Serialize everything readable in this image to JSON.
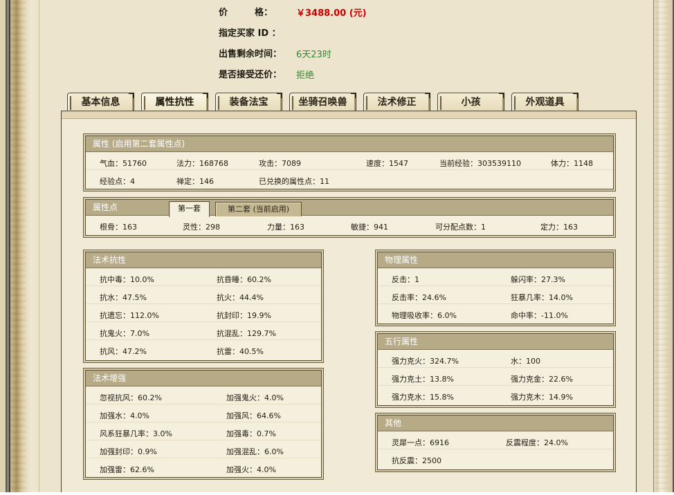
{
  "header": {
    "price_label": "价　　　格：",
    "price_value": "￥3488.00 (元)",
    "buyer_label": "指定买家 ID ：",
    "buyer_value": "",
    "time_label": "出售剩余时间：",
    "time_value": "6天23时",
    "counter_label": "是否接受还价：",
    "counter_value": "拒绝"
  },
  "tabs": [
    "基本信息",
    "属性抗性",
    "装备法宝",
    "坐骑召唤兽",
    "法术修正",
    "小孩",
    "外观道具"
  ],
  "active_tab": "属性抗性",
  "attributes": {
    "title": "属性 (启用第二套属性点)",
    "row1": [
      "气血：51760",
      "法力：168768",
      "攻击：7089",
      "速度：1547",
      "当前经验：303539110",
      "体力：1148"
    ],
    "row2": [
      "经验点：4",
      "禅定：146",
      "已兑换的属性点：11"
    ]
  },
  "points": {
    "title": "属性点",
    "subtabs": [
      "第一套",
      "第二套 (当前启用)"
    ],
    "active_subtab": "第一套",
    "values": [
      "根骨：163",
      "灵性：298",
      "力量：163",
      "敏捷：941",
      "可分配点数：1",
      "定力：163"
    ]
  },
  "spell_resist": {
    "title": "法术抗性",
    "rows": [
      [
        "抗中毒：10.0%",
        "抗昏睡：60.2%"
      ],
      [
        "抗水：47.5%",
        "抗火：44.4%"
      ],
      [
        "抗遗忘：112.0%",
        "抗封印：19.9%"
      ],
      [
        "抗鬼火：7.0%",
        "抗混乱：129.7%"
      ],
      [
        "抗风：47.2%",
        "抗雷：40.5%"
      ]
    ]
  },
  "spell_boost": {
    "title": "法术增强",
    "rows": [
      [
        "忽视抗风：60.2%",
        "加强鬼火：4.0%"
      ],
      [
        "加强水：4.0%",
        "加强风：64.6%"
      ],
      [
        "风系狂暴几率：3.0%",
        "加强毒：0.7%"
      ],
      [
        "加强封印：0.9%",
        "加强混乱：6.0%"
      ],
      [
        "加强雷：62.6%",
        "加强火：4.0%"
      ]
    ]
  },
  "physical": {
    "title": "物理属性",
    "rows": [
      [
        "反击：1",
        "躲闪率：27.3%"
      ],
      [
        "反击率：24.6%",
        "狂暴几率：14.0%"
      ],
      [
        "物理吸收率：6.0%",
        "命中率：-11.0%"
      ]
    ]
  },
  "five_elements": {
    "title": "五行属性",
    "rows": [
      [
        "强力克火：324.7%",
        "水：100"
      ],
      [
        "强力克土：13.8%",
        "强力克金：22.6%"
      ],
      [
        "强力克水：15.8%",
        "强力克木：14.9%"
      ]
    ]
  },
  "other": {
    "title": "其他",
    "rows": [
      [
        "灵犀一点：6916",
        "反震程度：24.0%"
      ],
      [
        "抗反震：2500"
      ]
    ]
  }
}
